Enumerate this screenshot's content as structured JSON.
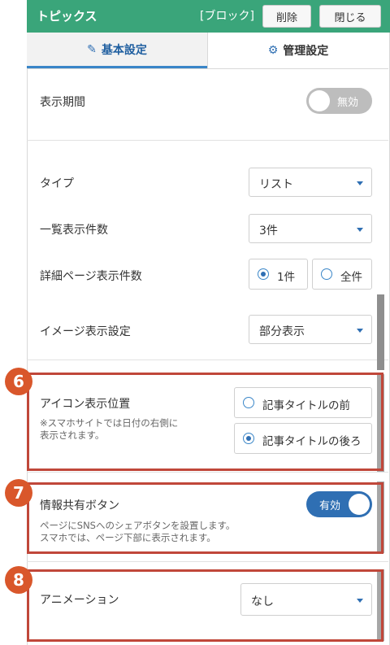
{
  "header": {
    "title": "トピックス",
    "block_label": "[ブロック]",
    "delete_label": "削除",
    "close_label": "閉じる"
  },
  "tabs": [
    {
      "label": "基本設定",
      "icon": "edit-icon",
      "active": true
    },
    {
      "label": "管理設定",
      "icon": "gear-icon",
      "active": false
    }
  ],
  "fields": {
    "display_period": {
      "label": "表示期間",
      "toggle": "無効",
      "enabled": false
    },
    "type": {
      "label": "タイプ",
      "value": "リスト"
    },
    "list_count": {
      "label": "一覧表示件数",
      "value": "3件"
    },
    "detail_count": {
      "label": "詳細ページ表示件数",
      "options": [
        "1件",
        "全件"
      ],
      "selected": "1件"
    },
    "image_setting": {
      "label": "イメージ表示設定",
      "value": "部分表示"
    },
    "icon_position": {
      "label": "アイコン表示位置",
      "note_line1": "※スマホサイトでは日付の右側に",
      "note_line2": "表示されます。",
      "options": [
        "記事タイトルの前",
        "記事タイトルの後ろ"
      ],
      "selected": "記事タイトルの後ろ"
    },
    "share_button": {
      "label": "情報共有ボタン",
      "toggle": "有効",
      "enabled": true,
      "note_line1": "ページにSNSへのシェアボタンを設置します。",
      "note_line2": "スマホでは、ページ下部に表示されます。"
    },
    "animation": {
      "label": "アニメーション",
      "value": "なし"
    }
  },
  "callouts": [
    "6",
    "7",
    "8"
  ],
  "colors": {
    "header_bg": "#3aa57a",
    "accent": "#2f6fb3",
    "highlight": "#c0473a",
    "badge": "#d9572b"
  }
}
